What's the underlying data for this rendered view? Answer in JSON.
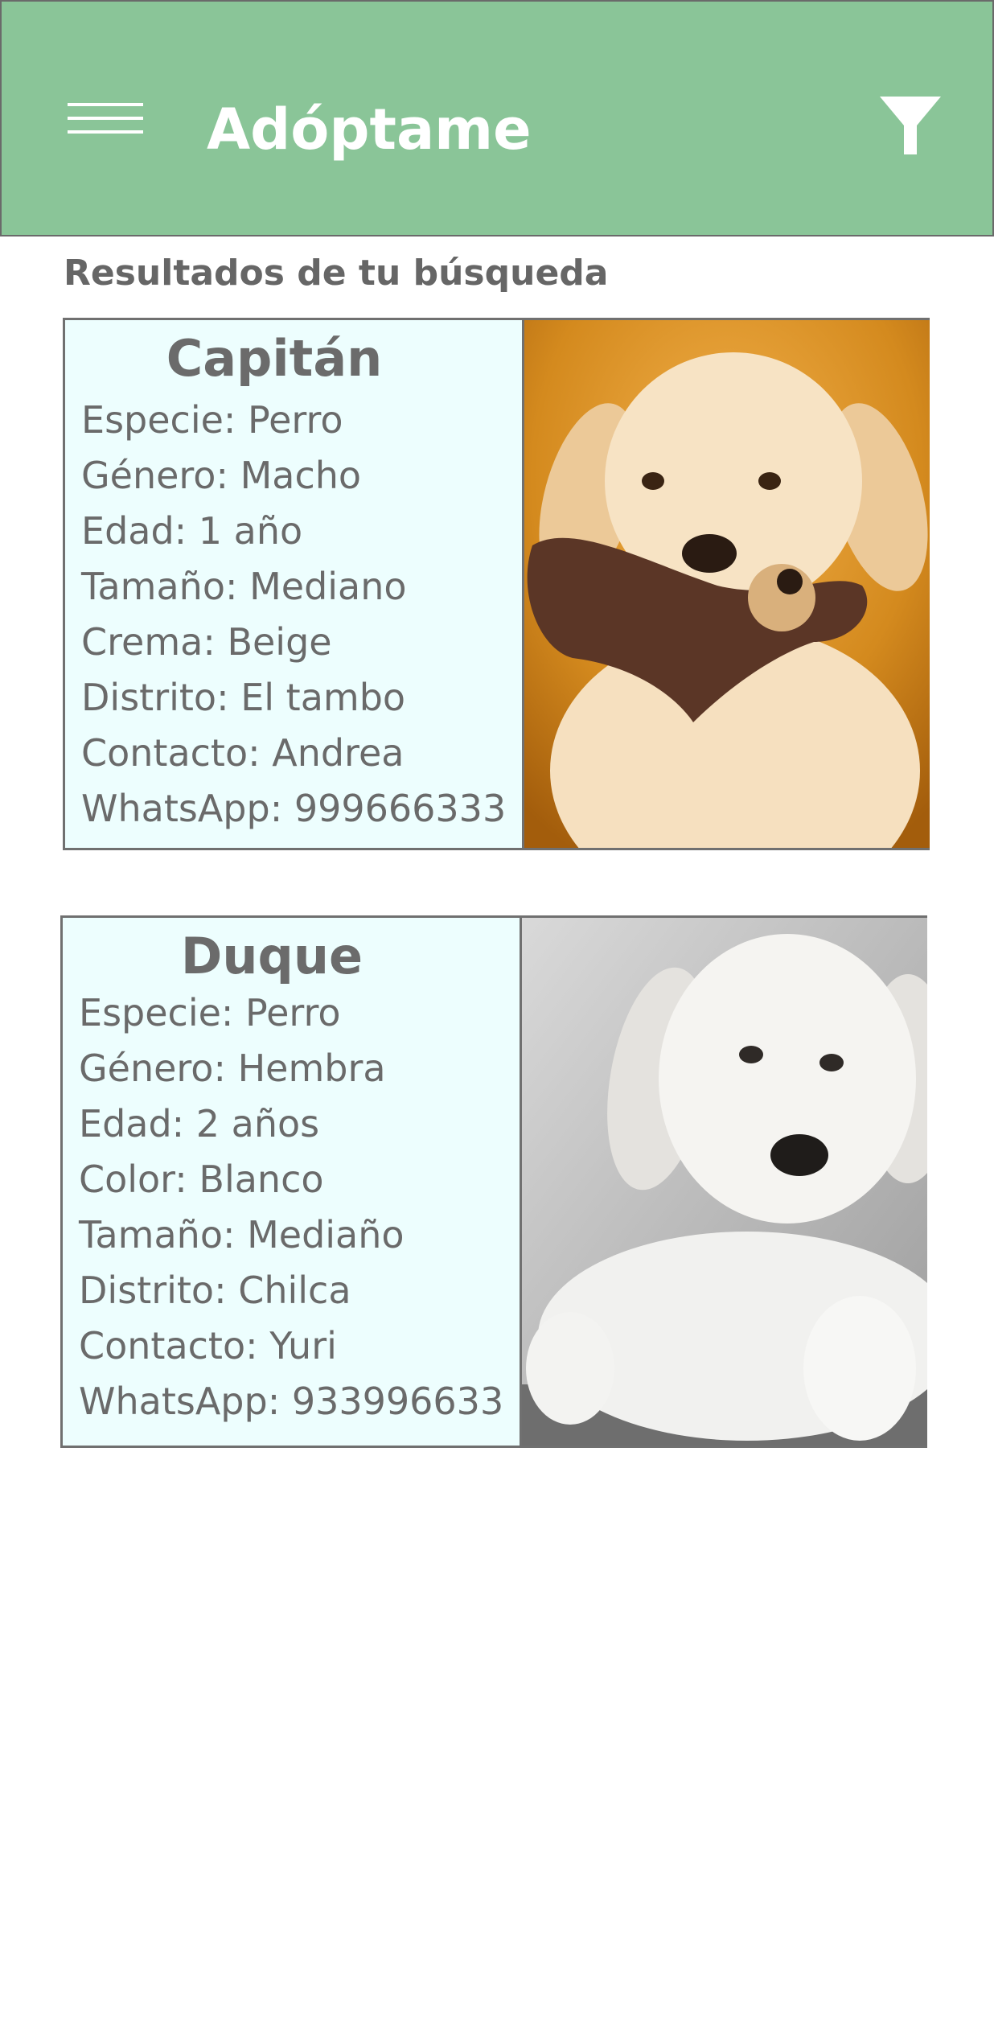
{
  "app_bar": {
    "title": "Adóptame",
    "background_color": "#8ac598",
    "menu_icon": "hamburger-menu-icon",
    "filter_icon": "filter-funnel-icon"
  },
  "results": {
    "heading": "Resultados de tu búsqueda",
    "cards": [
      {
        "name": "Capitán",
        "fields": [
          "Especie: Perro",
          "Género: Macho",
          "Edad: 1 año",
          "Tamaño: Mediano",
          "Crema: Beige",
          "Distrito: El tambo",
          "Contacto: Andrea",
          "WhatsApp: 999666333"
        ],
        "photo": "golden-retriever-puppy-with-plush-toy"
      },
      {
        "name": "Duque",
        "fields": [
          "Especie: Perro",
          "Género: Hembra",
          "Edad: 2 años",
          "Color: Blanco",
          "Tamaño: Mediaño",
          "Distrito: Chilca",
          "Contacto: Yuri",
          "WhatsApp: 933996633"
        ],
        "photo": "white-retriever-puppy-lying-down"
      }
    ]
  },
  "colors": {
    "card_background": "#edfefe",
    "card_border": "#707070",
    "text": "#6a6a6a"
  }
}
